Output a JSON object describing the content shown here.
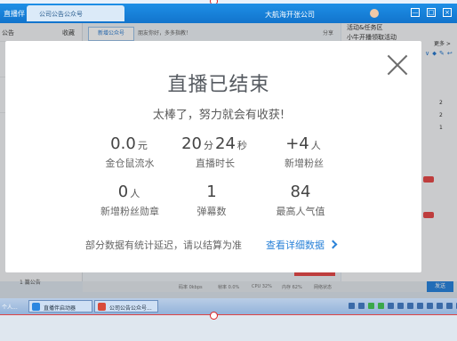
{
  "app": {
    "name": "直播伴",
    "tab_label": "公司公告公众号",
    "window_title": "大航海开张公司",
    "window_buttons": [
      "—",
      "□",
      "×"
    ]
  },
  "background": {
    "left": {
      "header": "公告",
      "collect": "收藏",
      "footer": "1 篇公告"
    },
    "center": {
      "chip": "新增公众号",
      "greeting": "朋友你好，多多指教！",
      "share": "分享"
    },
    "right": {
      "header": "活动&任务区",
      "activity": "小牛开播领取活动",
      "more": "更多 >",
      "tools": "∨⬥✎↩",
      "numbers": [
        "2",
        "2",
        "1"
      ]
    },
    "statusbar": {
      "bitrate": "码率 0kbps",
      "cpu_use": "帧率 0.0%",
      "cpu": "CPU 32%",
      "mem": "内存 62%",
      "net": "网络状态"
    },
    "send_label": "发送"
  },
  "taskbar": {
    "start": "个人...",
    "tasks": [
      "直播伴启动器",
      "公司公告公众号..."
    ]
  },
  "modal": {
    "title": "直播已结束",
    "subtitle": "太棒了，努力就会有收获!",
    "stats": [
      {
        "value": "0.0",
        "unit": "元",
        "label": "金仓鼠流水"
      },
      {
        "value_a": "20",
        "unit_a": "分",
        "value_b": "24",
        "unit_b": "秒",
        "label": "直播时长"
      },
      {
        "value": "+4",
        "unit": "人",
        "label": "新增粉丝"
      },
      {
        "value": "0",
        "unit": "人",
        "label": "新增粉丝勋章"
      },
      {
        "value": "1",
        "unit": "",
        "label": "弹幕数"
      },
      {
        "value": "84",
        "unit": "",
        "label": "最高人气值"
      }
    ],
    "note": "部分数据有统计延迟，请以结算为准",
    "detail_link": "查看详细数据"
  }
}
